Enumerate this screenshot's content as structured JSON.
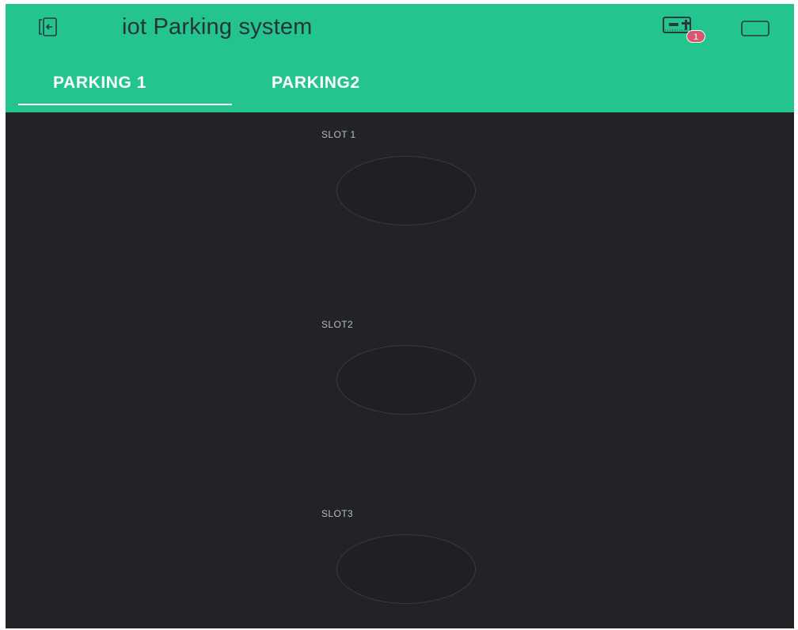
{
  "header": {
    "title": "iot Parking system",
    "notification_count": "1",
    "background_color": "#23c48e"
  },
  "icons": {
    "back": "exit-app-icon",
    "notifications": "device-notification-icon",
    "fullscreen": "fullscreen-icon"
  },
  "tabs": [
    {
      "label": "PARKING 1",
      "active": true
    },
    {
      "label": "PARKING2",
      "active": false
    }
  ],
  "dashboard": {
    "background_color": "#222327",
    "slots": [
      {
        "label": "SLOT 1",
        "led_on": false
      },
      {
        "label": "SLOT2",
        "led_on": false
      },
      {
        "label": "SLOT3",
        "led_on": false
      }
    ]
  }
}
